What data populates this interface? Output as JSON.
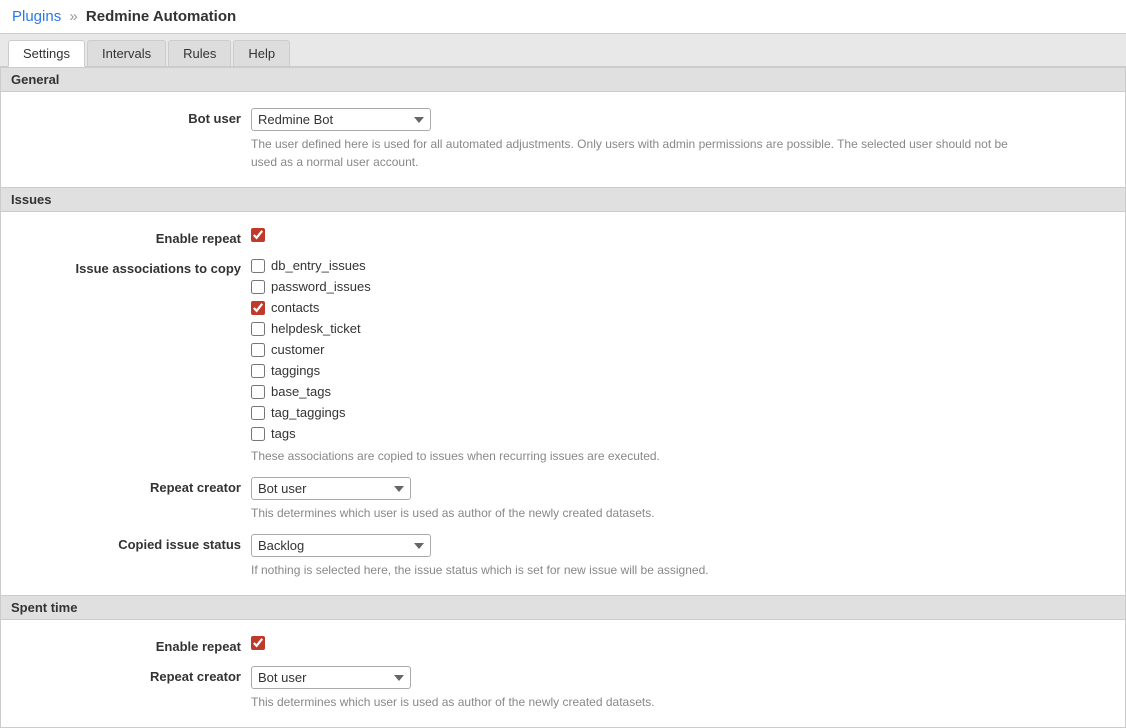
{
  "breadcrumb": {
    "plugins_label": "Plugins",
    "separator": "»",
    "current_page": "Redmine Automation"
  },
  "tabs": [
    {
      "id": "settings",
      "label": "Settings",
      "active": true
    },
    {
      "id": "intervals",
      "label": "Intervals",
      "active": false
    },
    {
      "id": "rules",
      "label": "Rules",
      "active": false
    },
    {
      "id": "help",
      "label": "Help",
      "active": false
    }
  ],
  "general_section": {
    "title": "General",
    "bot_user_label": "Bot user",
    "bot_user_value": "Redmine Bot",
    "bot_user_hint": "The user defined here is used for all automated adjustments. Only users with admin permissions are possible. The selected user should not be used as a normal user account."
  },
  "issues_section": {
    "title": "Issues",
    "enable_repeat_label": "Enable repeat",
    "enable_repeat_checked": true,
    "issue_associations_label": "Issue associations to copy",
    "associations": [
      {
        "id": "db_entry_issues",
        "label": "db_entry_issues",
        "checked": false
      },
      {
        "id": "password_issues",
        "label": "password_issues",
        "checked": false
      },
      {
        "id": "contacts",
        "label": "contacts",
        "checked": true
      },
      {
        "id": "helpdesk_ticket",
        "label": "helpdesk_ticket",
        "checked": false
      },
      {
        "id": "customer",
        "label": "customer",
        "checked": false
      },
      {
        "id": "taggings",
        "label": "taggings",
        "checked": false
      },
      {
        "id": "base_tags",
        "label": "base_tags",
        "checked": false
      },
      {
        "id": "tag_taggings",
        "label": "tag_taggings",
        "checked": false
      },
      {
        "id": "tags",
        "label": "tags",
        "checked": false
      }
    ],
    "associations_hint": "These associations are copied to issues when recurring issues are executed.",
    "repeat_creator_label": "Repeat creator",
    "repeat_creator_value": "Bot user",
    "repeat_creator_hint": "This determines which user is used as author of the newly created datasets.",
    "copied_issue_status_label": "Copied issue status",
    "copied_issue_status_value": "Backlog",
    "copied_issue_status_hint": "If nothing is selected here, the issue status which is set for new issue will be assigned."
  },
  "spent_time_section": {
    "title": "Spent time",
    "enable_repeat_label": "Enable repeat",
    "enable_repeat_checked": true,
    "repeat_creator_label": "Repeat creator",
    "repeat_creator_value": "Bot user",
    "repeat_creator_hint": "This determines which user is used as author of the newly created datasets."
  }
}
